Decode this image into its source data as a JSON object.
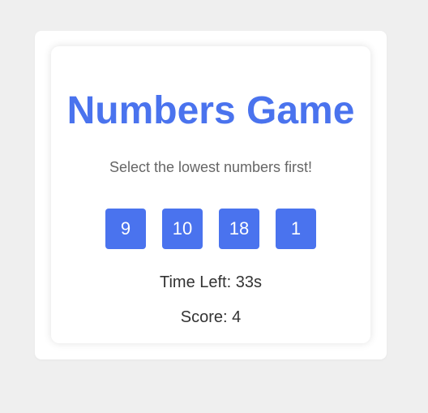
{
  "game": {
    "title": "Numbers Game",
    "instruction": "Select the lowest numbers first!",
    "numbers": [
      "9",
      "10",
      "18",
      "1"
    ],
    "time_label": "Time Left: ",
    "time_value": "33s",
    "score_label": "Score: ",
    "score_value": "4"
  },
  "colors": {
    "accent": "#4a73ee",
    "background": "#efefef",
    "card": "#ffffff",
    "subtitle_text": "#666666",
    "body_text": "#333333"
  }
}
